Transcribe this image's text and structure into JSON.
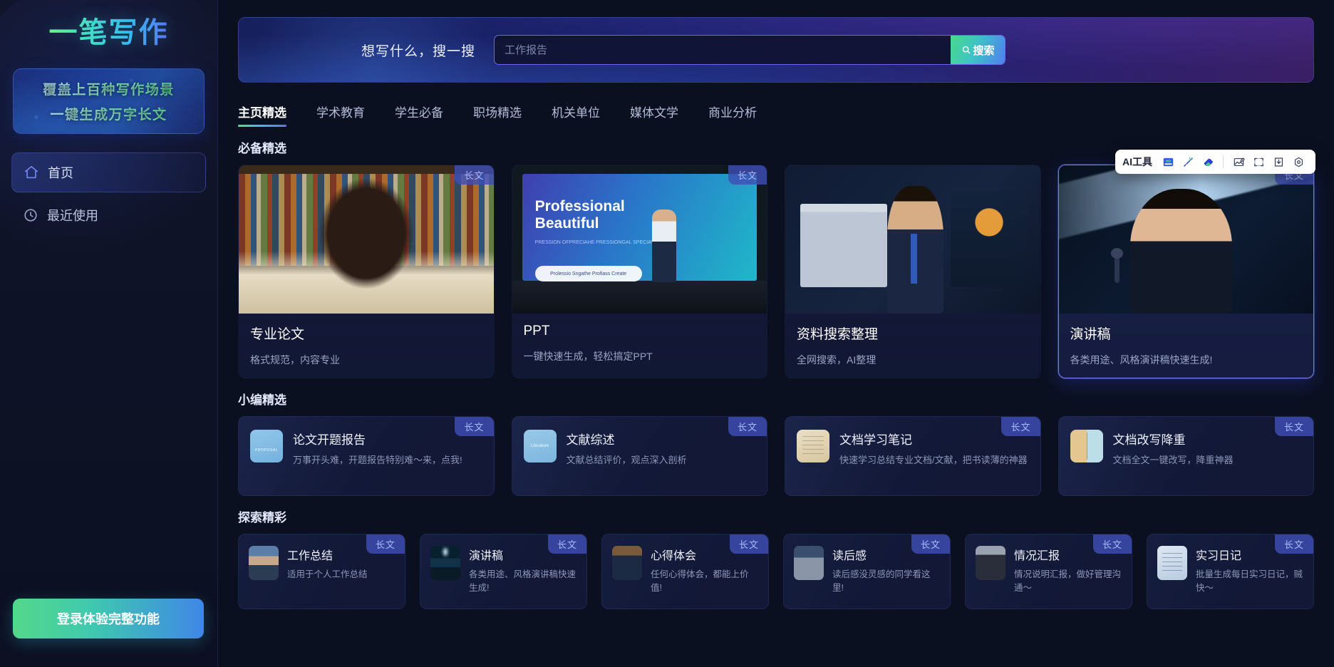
{
  "app": {
    "name": "一笔写作"
  },
  "sidebar": {
    "logo": "一笔写作",
    "promo": {
      "line1": "覆盖上百种写作场景",
      "line2": "一键生成万字长文"
    },
    "nav": [
      {
        "label": "首页",
        "icon": "home-icon",
        "active": true
      },
      {
        "label": "最近使用",
        "icon": "clock-icon",
        "active": false
      }
    ],
    "login_button": "登录体验完整功能"
  },
  "hero": {
    "label": "想写什么，搜一搜",
    "search_placeholder": "工作报告",
    "search_value": "",
    "search_button": "搜索"
  },
  "tabs": [
    {
      "label": "主页精选",
      "active": true
    },
    {
      "label": "学术教育",
      "active": false
    },
    {
      "label": "学生必备",
      "active": false
    },
    {
      "label": "职场精选",
      "active": false
    },
    {
      "label": "机关单位",
      "active": false
    },
    {
      "label": "媒体文学",
      "active": false
    },
    {
      "label": "商业分析",
      "active": false
    }
  ],
  "badge_label": "长文",
  "sections": {
    "featured": {
      "title": "必备精选",
      "cards": [
        {
          "title": "专业论文",
          "desc": "格式规范，内容专业",
          "badge": "长文",
          "selected": false
        },
        {
          "title": "PPT",
          "desc": "一键快速生成，轻松搞定PPT",
          "badge": "长文",
          "selected": false,
          "slide_title_1": "Professional",
          "slide_title_2": "Beautiful",
          "slide_sub": "PRESSION OFPRECIAHE PRESSIONGAL SPECIAVIOR",
          "slide_pill": "Prolessio Sngathe Profiass Create"
        },
        {
          "title": "资料搜索整理",
          "desc": "全网搜索，AI整理",
          "badge": "",
          "selected": false
        },
        {
          "title": "演讲稿",
          "desc": "各类用途、风格演讲稿快速生成!",
          "badge": "长文",
          "selected": true
        }
      ]
    },
    "editor_picks": {
      "title": "小编精选",
      "cards": [
        {
          "title": "论文开题报告",
          "desc": "万事开头难，开题报告特别难～来，点我!",
          "badge": "长文",
          "thumb": "proposal-thumb",
          "thumb_text": "PROPOSAL"
        },
        {
          "title": "文献综述",
          "desc": "文献总结评价，观点深入剖析",
          "badge": "长文",
          "thumb": "literature-thumb",
          "thumb_text": "Literature"
        },
        {
          "title": "文档学习笔记",
          "desc": "快速学习总结专业文档/文献，把书读薄的神器",
          "badge": "长文",
          "thumb": "note-thumb",
          "thumb_text": ""
        },
        {
          "title": "文档改写降重",
          "desc": "文档全文一键改写，降重神器",
          "badge": "长文",
          "thumb": "rewrite-thumb",
          "thumb_text": ""
        }
      ]
    },
    "explore": {
      "title": "探索精彩",
      "cards": [
        {
          "title": "工作总结",
          "desc": "适用于个人工作总结",
          "badge": "长文",
          "thumb": "work-thumb"
        },
        {
          "title": "演讲稿",
          "desc": "各类用途、风格演讲稿快速生成!",
          "badge": "长文",
          "thumb": "stage-thumb"
        },
        {
          "title": "心得体会",
          "desc": "任何心得体会，都能上价值!",
          "badge": "长文",
          "thumb": "insight-thumb"
        },
        {
          "title": "读后感",
          "desc": "读后感没灵感的同学看这里!",
          "badge": "长文",
          "thumb": "book-thumb"
        },
        {
          "title": "情况汇报",
          "desc": "情况说明汇报，做好管理沟通～",
          "badge": "长文",
          "thumb": "report-thumb"
        },
        {
          "title": "实习日记",
          "desc": "批量生成每日实习日记，贼快～",
          "badge": "长文",
          "thumb": "diary-thumb"
        }
      ]
    }
  },
  "toolbar": {
    "label": "AI工具",
    "buttons": [
      {
        "name": "hd-capture-icon",
        "label": "HD"
      },
      {
        "name": "magic-wand-icon",
        "label": ""
      },
      {
        "name": "eraser-icon",
        "label": ""
      },
      {
        "name": "image-edit-icon",
        "label": ""
      },
      {
        "name": "crop-frame-icon",
        "label": ""
      },
      {
        "name": "download-icon",
        "label": ""
      },
      {
        "name": "settings-gear-icon",
        "label": ""
      }
    ]
  },
  "colors": {
    "accent_green": "#49d98b",
    "accent_blue": "#4f7ff0",
    "accent_purple": "#6f66e6",
    "background": "#0b1021",
    "badge_bg": "#3e4eb4"
  }
}
